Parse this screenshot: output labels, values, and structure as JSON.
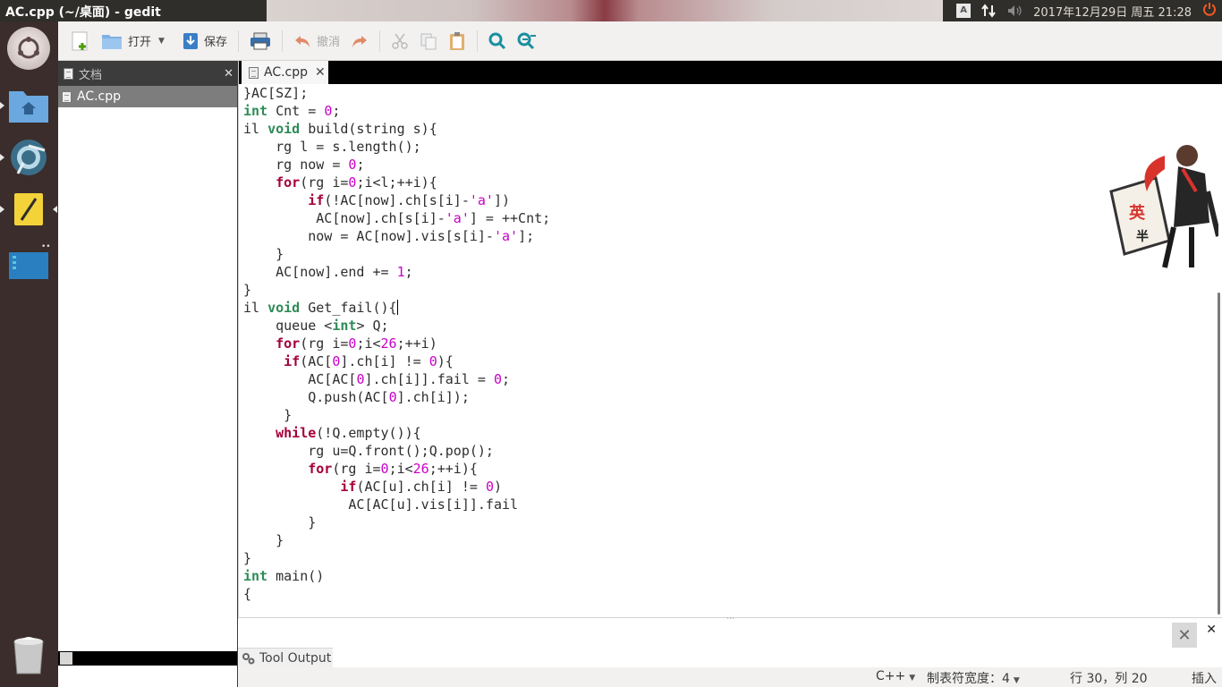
{
  "window": {
    "title": "AC.cpp (~/桌面) - gedit"
  },
  "panel": {
    "keyboard_indicator": "A",
    "clock": "2017年12月29日 周五 21:28",
    "icons": [
      "keyboard-icon",
      "network-icon",
      "volume-icon",
      "power-icon"
    ]
  },
  "launcher": {
    "items": [
      "dash-icon",
      "home-folder-icon",
      "chromium-icon",
      "gedit-icon",
      "workspace-icon",
      "trash-icon"
    ]
  },
  "toolbar": {
    "new_label": "",
    "open_label": "打开",
    "save_label": "保存",
    "undo_label": "撤消",
    "colors": {
      "open_folder": "#5e9fd8",
      "save": "#3a7fc6",
      "search": "#1a8fa0"
    }
  },
  "side_panel": {
    "title": "文档",
    "documents": [
      "AC.cpp"
    ]
  },
  "tabs": [
    {
      "label": "AC.cpp",
      "active": true
    }
  ],
  "code": {
    "lines": [
      [
        {
          "t": "}AC[SZ];"
        }
      ],
      [
        {
          "t": "int",
          "c": "ty"
        },
        {
          "t": " Cnt = "
        },
        {
          "t": "0",
          "c": "num"
        },
        {
          "t": ";"
        }
      ],
      [
        {
          "t": "il "
        },
        {
          "t": "void",
          "c": "ty"
        },
        {
          "t": " build(string s){"
        }
      ],
      [
        {
          "t": "    rg l = s.length();"
        }
      ],
      [
        {
          "t": "    rg now = "
        },
        {
          "t": "0",
          "c": "num"
        },
        {
          "t": ";"
        }
      ],
      [
        {
          "t": "    "
        },
        {
          "t": "for",
          "c": "kw"
        },
        {
          "t": "(rg i="
        },
        {
          "t": "0",
          "c": "num"
        },
        {
          "t": ";i<l;++i){"
        }
      ],
      [
        {
          "t": "        "
        },
        {
          "t": "if",
          "c": "kw"
        },
        {
          "t": "(!AC[now].ch[s[i]-"
        },
        {
          "t": "'a'",
          "c": "str"
        },
        {
          "t": "])"
        }
      ],
      [
        {
          "t": "         AC[now].ch[s[i]-"
        },
        {
          "t": "'a'",
          "c": "str"
        },
        {
          "t": "] = ++Cnt;"
        }
      ],
      [
        {
          "t": "        now = AC[now].vis[s[i]-"
        },
        {
          "t": "'a'",
          "c": "str"
        },
        {
          "t": "];"
        }
      ],
      [
        {
          "t": "    }"
        }
      ],
      [
        {
          "t": "    AC[now].end += "
        },
        {
          "t": "1",
          "c": "num"
        },
        {
          "t": ";"
        }
      ],
      [
        {
          "t": "}"
        }
      ],
      [
        {
          "t": "il "
        },
        {
          "t": "void",
          "c": "ty"
        },
        {
          "t": " Get_fail(){"
        }
      ],
      [
        {
          "t": "    queue <"
        },
        {
          "t": "int",
          "c": "ty"
        },
        {
          "t": "> Q;"
        }
      ],
      [
        {
          "t": "    "
        },
        {
          "t": "for",
          "c": "kw"
        },
        {
          "t": "(rg i="
        },
        {
          "t": "0",
          "c": "num"
        },
        {
          "t": ";i<"
        },
        {
          "t": "26",
          "c": "num"
        },
        {
          "t": ";++i)"
        }
      ],
      [
        {
          "t": "     "
        },
        {
          "t": "if",
          "c": "kw"
        },
        {
          "t": "(AC["
        },
        {
          "t": "0",
          "c": "num"
        },
        {
          "t": "].ch[i] != "
        },
        {
          "t": "0",
          "c": "num"
        },
        {
          "t": "){"
        }
      ],
      [
        {
          "t": "        AC[AC["
        },
        {
          "t": "0",
          "c": "num"
        },
        {
          "t": "].ch[i]].fail = "
        },
        {
          "t": "0",
          "c": "num"
        },
        {
          "t": ";"
        }
      ],
      [
        {
          "t": "        Q.push(AC["
        },
        {
          "t": "0",
          "c": "num"
        },
        {
          "t": "].ch[i]);"
        }
      ],
      [
        {
          "t": "     }"
        }
      ],
      [
        {
          "t": "    "
        },
        {
          "t": "while",
          "c": "kw"
        },
        {
          "t": "(!Q.empty()){"
        }
      ],
      [
        {
          "t": "        rg u=Q.front();Q.pop();"
        }
      ],
      [
        {
          "t": "        "
        },
        {
          "t": "for",
          "c": "kw"
        },
        {
          "t": "(rg i="
        },
        {
          "t": "0",
          "c": "num"
        },
        {
          "t": ";i<"
        },
        {
          "t": "26",
          "c": "num"
        },
        {
          "t": ";++i){"
        }
      ],
      [
        {
          "t": "            "
        },
        {
          "t": "if",
          "c": "kw"
        },
        {
          "t": "(AC[u].ch[i] != "
        },
        {
          "t": "0",
          "c": "num"
        },
        {
          "t": ")"
        }
      ],
      [
        {
          "t": "             AC[AC[u].vis[i]].fail"
        }
      ],
      [
        {
          "t": "        }"
        }
      ],
      [
        {
          "t": "    }"
        }
      ],
      [
        {
          "t": "}"
        }
      ],
      [
        {
          "t": "int",
          "c": "ty"
        },
        {
          "t": " main()"
        }
      ],
      [
        {
          "t": "{"
        }
      ]
    ],
    "cursor_line": 12
  },
  "sticker": {
    "chars": [
      "英",
      "半"
    ],
    "accent": "#d8332b"
  },
  "bottom_panel": {
    "tab_label": "Tool Output"
  },
  "statusbar": {
    "language": "C++",
    "tab_width": "制表符宽度：4",
    "position": "行 30，列 20",
    "mode": "插入"
  }
}
